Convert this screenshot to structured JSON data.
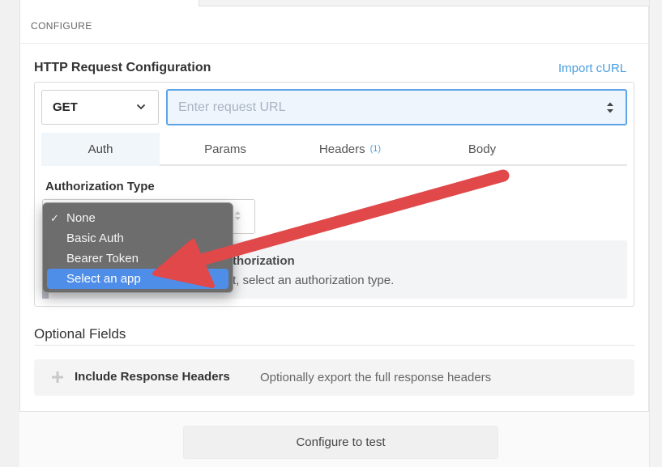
{
  "section_header": "CONFIGURE",
  "http": {
    "title": "HTTP Request Configuration",
    "import_label": "Import cURL",
    "method": "GET",
    "url_placeholder": "Enter request URL"
  },
  "tabs": [
    {
      "label": "Auth",
      "active": true
    },
    {
      "label": "Params"
    },
    {
      "label": "Headers",
      "badge": "(1)"
    },
    {
      "label": "Body"
    }
  ],
  "auth": {
    "type_label": "Authorization Type",
    "options": [
      {
        "label": "None",
        "checked": true
      },
      {
        "label": "Basic Auth"
      },
      {
        "label": "Bearer Token"
      },
      {
        "label": "Select an app",
        "highlighted": true
      }
    ],
    "info_title_visible": "thorization",
    "info_text_visible": "t, select an authorization type."
  },
  "optional": {
    "title": "Optional Fields",
    "include_label": "Include Response Headers",
    "include_desc": "Optionally export the full response headers"
  },
  "footer": {
    "configure_button": "Configure to test"
  },
  "colors": {
    "accent": "#4a9fe0",
    "focus_border": "#5da5e6",
    "highlight": "#4f8ee8",
    "arrow": "#e0484a"
  },
  "icons": {
    "method_chevron": "chevron-down-icon",
    "url_stepper": "up-down-stepper-icon",
    "plus": "plus-icon",
    "check": "checkmark-icon",
    "annotation": "arrow-annotation"
  }
}
